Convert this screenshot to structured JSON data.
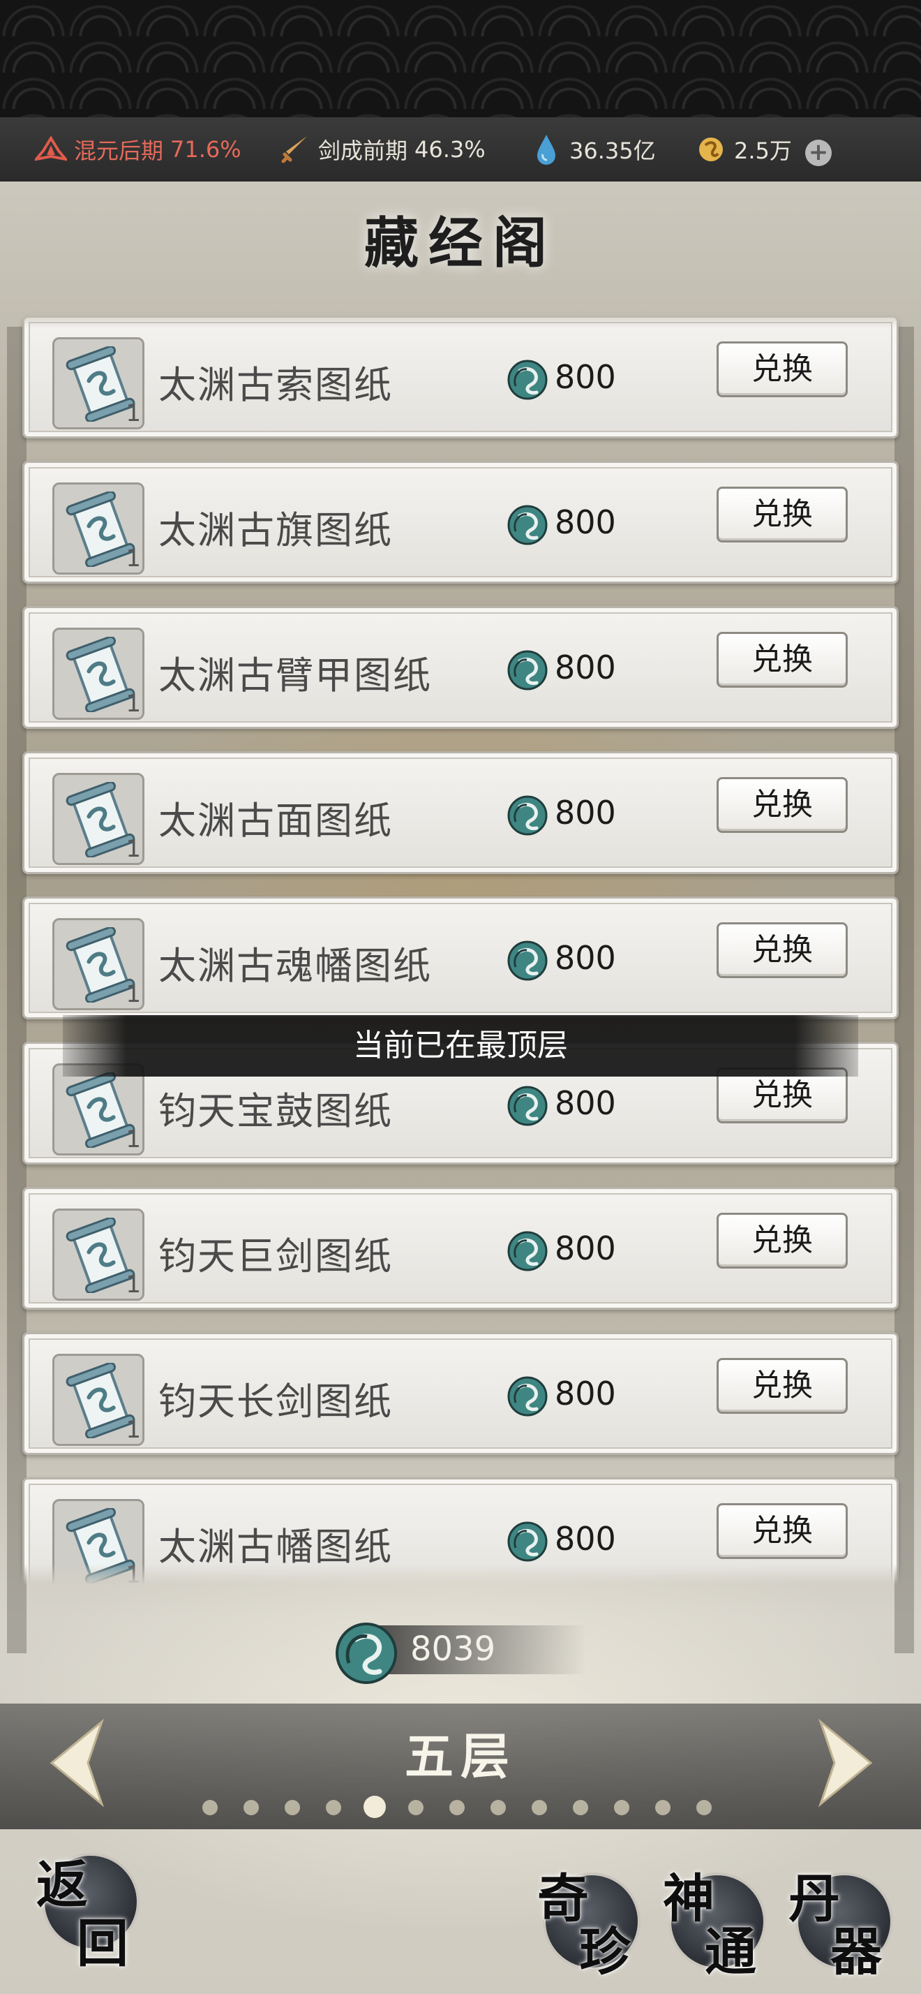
{
  "status_bar": {
    "realm1": {
      "label": "混元后期",
      "percent": "71.6%"
    },
    "realm2": {
      "label": "剑成前期",
      "percent": "46.3%"
    },
    "resource1": "36.35亿",
    "resource2": "2.5万",
    "add_icon": "plus-icon"
  },
  "page": {
    "title": "藏经阁"
  },
  "items": [
    {
      "name": "太渊古索图纸",
      "count": "1",
      "price": "800",
      "button": "兑换"
    },
    {
      "name": "太渊古旗图纸",
      "count": "1",
      "price": "800",
      "button": "兑换"
    },
    {
      "name": "太渊古臂甲图纸",
      "count": "1",
      "price": "800",
      "button": "兑换"
    },
    {
      "name": "太渊古面图纸",
      "count": "1",
      "price": "800",
      "button": "兑换"
    },
    {
      "name": "太渊古魂幡图纸",
      "count": "1",
      "price": "800",
      "button": "兑换"
    },
    {
      "name": "钧天宝鼓图纸",
      "count": "1",
      "price": "800",
      "button": "兑换"
    },
    {
      "name": "钧天巨剑图纸",
      "count": "1",
      "price": "800",
      "button": "兑换"
    },
    {
      "name": "钧天长剑图纸",
      "count": "1",
      "price": "800",
      "button": "兑换"
    },
    {
      "name": "太渊古幡图纸",
      "count": "1",
      "price": "800",
      "button": "兑换"
    }
  ],
  "toast": "当前已在最顶层",
  "currency_total": "8039",
  "floor": {
    "name": "五层",
    "page_count": 13,
    "active_index": 4
  },
  "bottom_nav": {
    "back": [
      "返",
      "回"
    ],
    "qizhen": [
      "奇",
      "珍"
    ],
    "shentong": [
      "神",
      "通"
    ],
    "danqi": [
      "丹",
      "器"
    ]
  },
  "colors": {
    "realm_red": "#e46a5a",
    "accent_teal": "#3d7d7b"
  }
}
